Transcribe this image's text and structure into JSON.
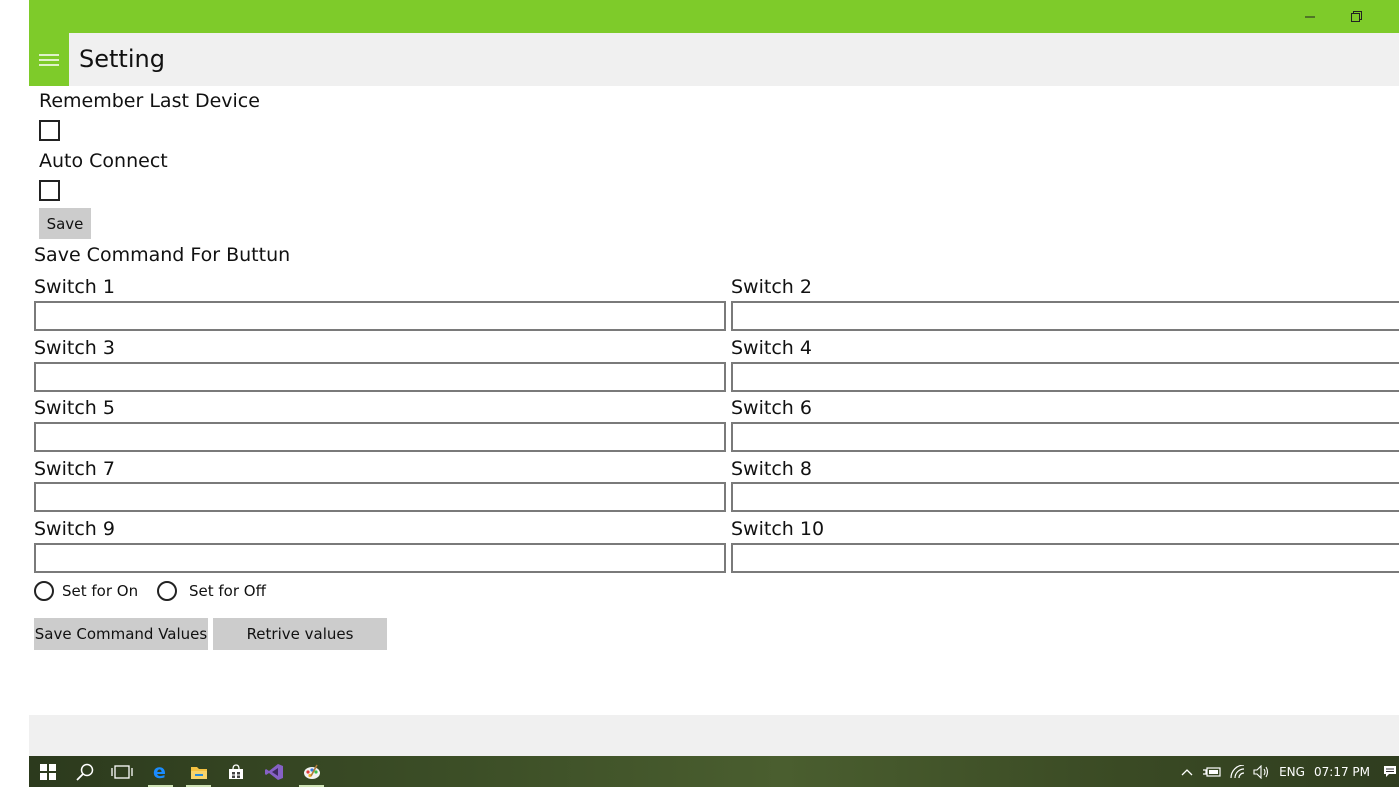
{
  "header": {
    "title": "Setting"
  },
  "settings": {
    "remember_label": "Remember Last Device",
    "auto_connect_label": "Auto Connect",
    "save_label": "Save"
  },
  "commands": {
    "section_label": "Save Command For Buttun",
    "switches": [
      {
        "label": "Switch 1",
        "value": ""
      },
      {
        "label": "Switch 2",
        "value": ""
      },
      {
        "label": "Switch 3",
        "value": ""
      },
      {
        "label": "Switch 4",
        "value": ""
      },
      {
        "label": "Switch 5",
        "value": ""
      },
      {
        "label": "Switch 6",
        "value": ""
      },
      {
        "label": "Switch 7",
        "value": ""
      },
      {
        "label": "Switch 8",
        "value": ""
      },
      {
        "label": "Switch 9",
        "value": ""
      },
      {
        "label": "Switch 10",
        "value": ""
      }
    ],
    "radio_on_label": "Set for On",
    "radio_off_label": "Set for Off",
    "save_values_label": "Save Command Values",
    "retrieve_label": "Retrive values"
  },
  "taskbar": {
    "language": "ENG",
    "time": "07:17 PM"
  },
  "colors": {
    "accent": "#7ecb2a",
    "header_bg": "#f0f0f0",
    "button_bg": "#cccccc"
  }
}
